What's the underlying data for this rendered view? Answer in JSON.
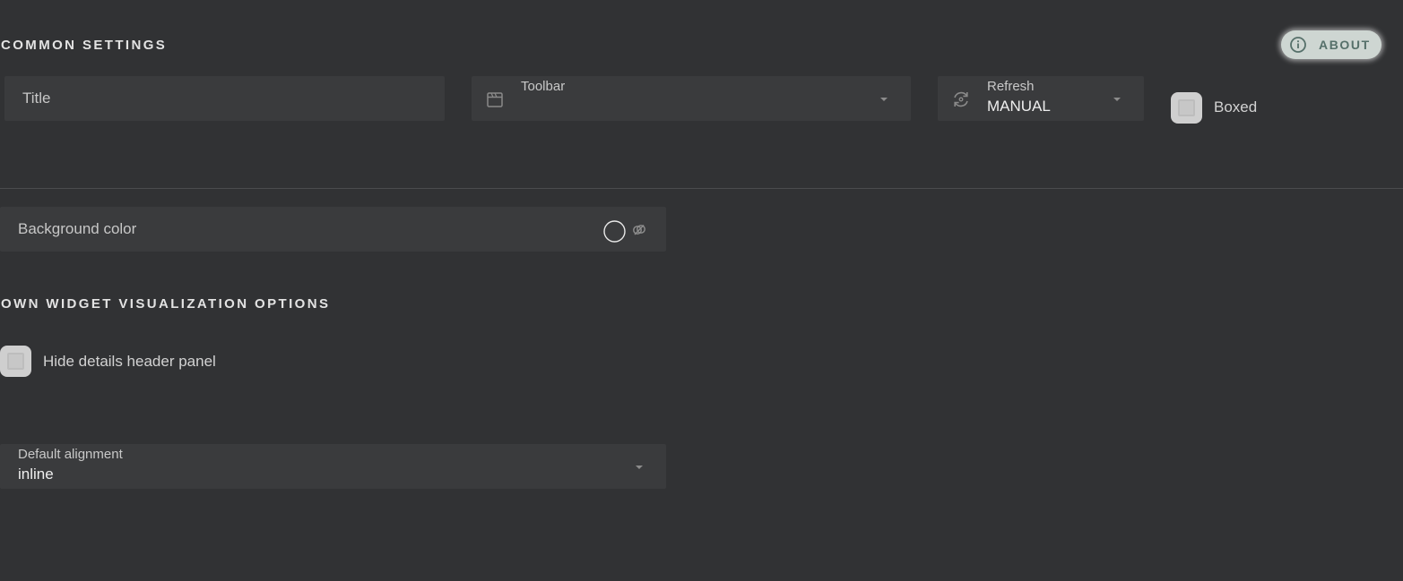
{
  "common_settings": {
    "heading": "COMMON SETTINGS",
    "about_label": "ABOUT",
    "title_field": {
      "placeholder": "Title"
    },
    "toolbar_field": {
      "label": "Toolbar",
      "value": ""
    },
    "refresh_field": {
      "label": "Refresh",
      "value": "MANUAL"
    },
    "boxed": {
      "label": "Boxed",
      "checked": false
    },
    "background_color": {
      "label": "Background color"
    }
  },
  "own_options": {
    "heading": "OWN WIDGET VISUALIZATION OPTIONS",
    "hide_details_header": {
      "label": "Hide details header panel",
      "checked": false
    },
    "default_alignment": {
      "label": "Default alignment",
      "value": "inline"
    }
  },
  "icons": {
    "about": "info-circle-icon",
    "toolbar": "calendar-icon",
    "refresh": "refresh-icon",
    "color_swatch": "color-circle-icon",
    "color_link": "link-icon"
  }
}
